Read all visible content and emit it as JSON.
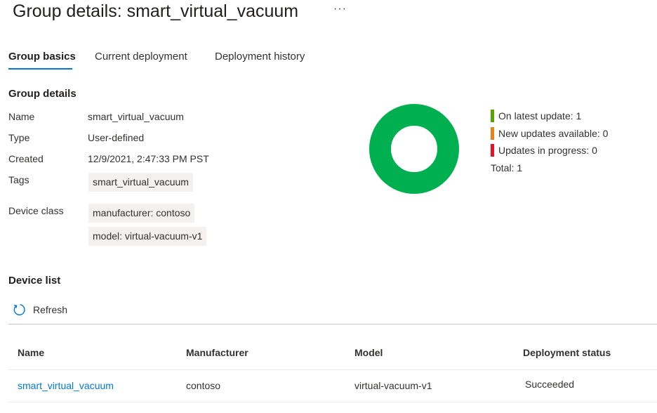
{
  "page": {
    "title": "Group details: smart_virtual_vacuum",
    "more_label": "···"
  },
  "tabs": [
    {
      "label": "Group basics",
      "active": true
    },
    {
      "label": "Current deployment",
      "active": false
    },
    {
      "label": "Deployment history",
      "active": false
    }
  ],
  "group_details": {
    "heading": "Group details",
    "name_label": "Name",
    "name_value": "smart_virtual_vacuum",
    "type_label": "Type",
    "type_value": "User-defined",
    "created_label": "Created",
    "created_value": "12/9/2021, 2:47:33 PM PST",
    "tags_label": "Tags",
    "tags": [
      "smart_virtual_vacuum"
    ],
    "device_class_label": "Device class",
    "device_class": [
      "manufacturer: contoso",
      "model: virtual-vacuum-v1"
    ]
  },
  "status_summary": {
    "items": [
      {
        "text": "On latest update: 1",
        "value": 1,
        "color": "#57a300"
      },
      {
        "text": "New updates available: 0",
        "value": 0,
        "color": "#e8821b"
      },
      {
        "text": "Updates in progress: 0",
        "value": 0,
        "color": "#e81123"
      }
    ],
    "total_text": "Total: 1",
    "donut_color": "#00b050",
    "icon": "donut-chart"
  },
  "device_list": {
    "heading": "Device list",
    "refresh_label": "Refresh",
    "refresh_icon": "refresh-icon",
    "columns": [
      "Name",
      "Manufacturer",
      "Model",
      "Deployment status"
    ],
    "rows": [
      {
        "name": "smart_virtual_vacuum",
        "manufacturer": "contoso",
        "model": "virtual-vacuum-v1",
        "status": "Succeeded"
      }
    ]
  },
  "colors": {
    "accent": "#0078d4",
    "divider_strong": "#c8c6c4",
    "divider_light": "#edebe9"
  }
}
